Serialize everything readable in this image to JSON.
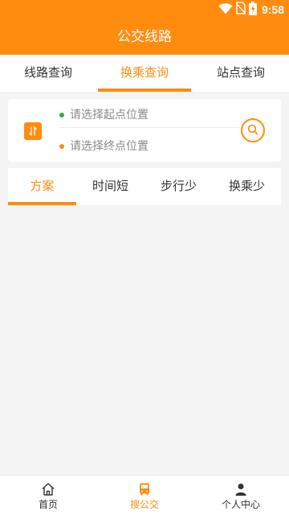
{
  "status_bar": {
    "time": "9:58"
  },
  "app": {
    "title": "公交线路"
  },
  "main_tabs": [
    {
      "label": "线路查询"
    },
    {
      "label": "换乘查询"
    },
    {
      "label": "站点查询"
    }
  ],
  "search": {
    "start_placeholder": "请选择起点位置",
    "end_placeholder": "请选择终点位置",
    "start_dot_color": "#22b33a",
    "end_dot_color": "#ff8c0f"
  },
  "plan_tabs": [
    {
      "label": "方案"
    },
    {
      "label": "时间短"
    },
    {
      "label": "步行少"
    },
    {
      "label": "换乘少"
    }
  ],
  "bottom_nav": [
    {
      "label": "首页",
      "icon": "home-icon"
    },
    {
      "label": "搜公交",
      "icon": "bus-icon"
    },
    {
      "label": "个人中心",
      "icon": "person-icon"
    }
  ],
  "colors": {
    "accent": "#ff8c0f",
    "background": "#f4f4f4"
  }
}
